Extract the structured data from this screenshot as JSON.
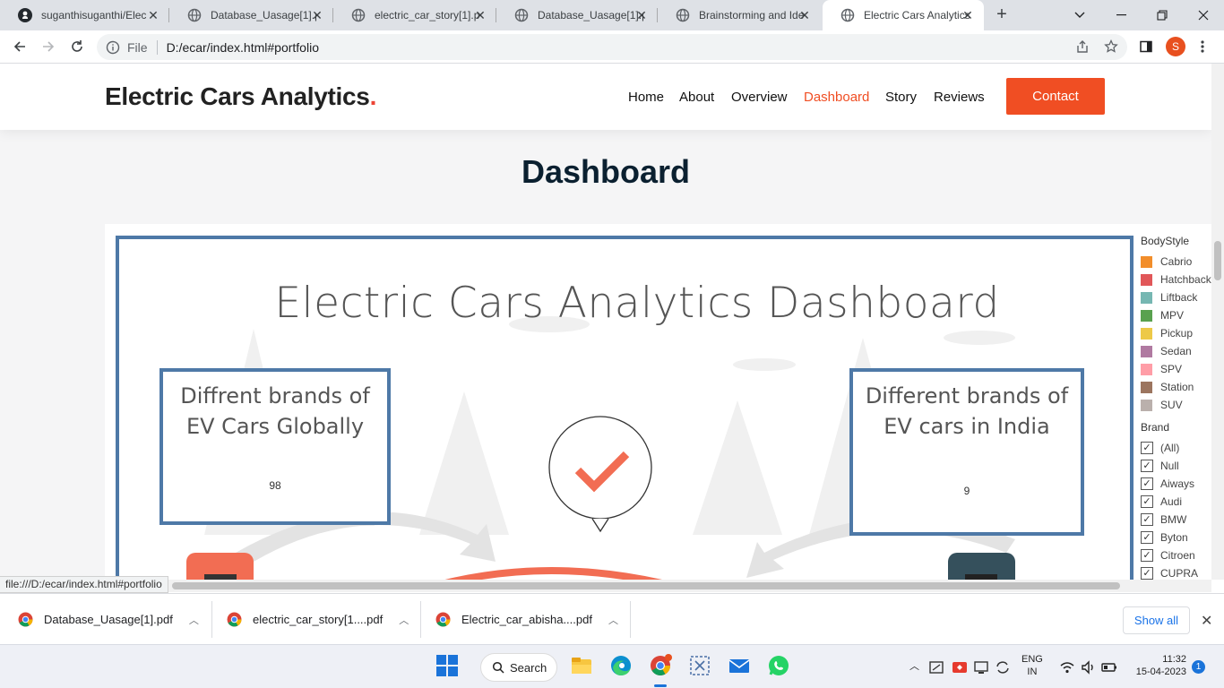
{
  "browser": {
    "tabs": [
      {
        "title": "suganthisuganthi/Elec",
        "icon": "github-icon"
      },
      {
        "title": "Database_Uasage[1].p",
        "icon": "globe-icon"
      },
      {
        "title": "electric_car_story[1].p",
        "icon": "globe-icon"
      },
      {
        "title": "Database_Uasage[1].p",
        "icon": "globe-icon"
      },
      {
        "title": "Brainstorming and Ide",
        "icon": "globe-icon"
      },
      {
        "title": "Electric Cars Analytics",
        "icon": "globe-icon"
      }
    ],
    "address": {
      "scheme_label": "File",
      "url": "D:/ecar/index.html#portfolio"
    },
    "profile_initial": "S",
    "status_url": "file:///D:/ecar/index.html#portfolio"
  },
  "site": {
    "brand": "Electric Cars Analytics",
    "brand_dot": ".",
    "nav": [
      "Home",
      "About",
      "Overview",
      "Dashboard",
      "Story",
      "Reviews"
    ],
    "active_nav": "Dashboard",
    "contact_label": "Contact",
    "section_title": "Dashboard",
    "accent": "#f04e23"
  },
  "dashboard": {
    "title": "Electric Cars Analytics Dashboard",
    "kpi_global": {
      "label": "Diffrent brands of EV Cars Globally",
      "value": "98"
    },
    "kpi_india": {
      "label": "Different brands of EV cars in India",
      "value": "9"
    },
    "frame_color": "#4e79a7",
    "bodystyle_header": "BodyStyle",
    "bodystyle": [
      {
        "label": "Cabrio",
        "color": "#f28e2b"
      },
      {
        "label": "Hatchback",
        "color": "#e15759"
      },
      {
        "label": "Liftback",
        "color": "#76b7b2"
      },
      {
        "label": "MPV",
        "color": "#59a14f"
      },
      {
        "label": "Pickup",
        "color": "#edc948"
      },
      {
        "label": "Sedan",
        "color": "#b07aa1"
      },
      {
        "label": "SPV",
        "color": "#ff9da7"
      },
      {
        "label": "Station",
        "color": "#9c755f"
      },
      {
        "label": "SUV",
        "color": "#bab0ac"
      }
    ],
    "brand_header": "Brand",
    "brands": [
      "(All)",
      "Null",
      "Aiways",
      "Audi",
      "BMW",
      "Byton",
      "Citroen",
      "CUPRA"
    ]
  },
  "downloads": {
    "items": [
      "Database_Uasage[1].pdf",
      "electric_car_story[1....pdf",
      "Electric_car_abisha....pdf"
    ],
    "show_all": "Show all"
  },
  "taskbar": {
    "search_label": "Search",
    "lang": "ENG",
    "region": "IN",
    "time": "11:32",
    "date": "15-04-2023",
    "notifications": "1"
  }
}
